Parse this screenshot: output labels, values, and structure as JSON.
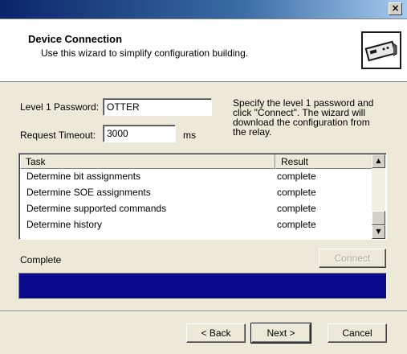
{
  "window": {
    "close_glyph": "×"
  },
  "header": {
    "title": "Device Connection",
    "subtitle": "Use this wizard to simplify configuration building.",
    "icon": "relay-device-icon"
  },
  "form": {
    "password_label": "Level 1 Password:",
    "password_value": "OTTER",
    "timeout_label": "Request Timeout:",
    "timeout_value": "3000",
    "timeout_unit": "ms",
    "hint": "Specify the level 1 password and click \"Connect\". The wizard will download the configuration from the relay."
  },
  "task_list": {
    "columns": [
      "Task",
      "Result"
    ],
    "rows": [
      {
        "task": "Determine bit assignments",
        "result": "complete"
      },
      {
        "task": "Determine SOE assignments",
        "result": "complete"
      },
      {
        "task": "Determine supported commands",
        "result": "complete"
      },
      {
        "task": "Determine history",
        "result": "complete"
      }
    ]
  },
  "status": {
    "label": "Complete",
    "connect_label": "Connect",
    "progress": 1.0,
    "progress_color": "#0a0a8c"
  },
  "footer": {
    "back_label": "< Back",
    "next_label": "Next >",
    "cancel_label": "Cancel"
  }
}
